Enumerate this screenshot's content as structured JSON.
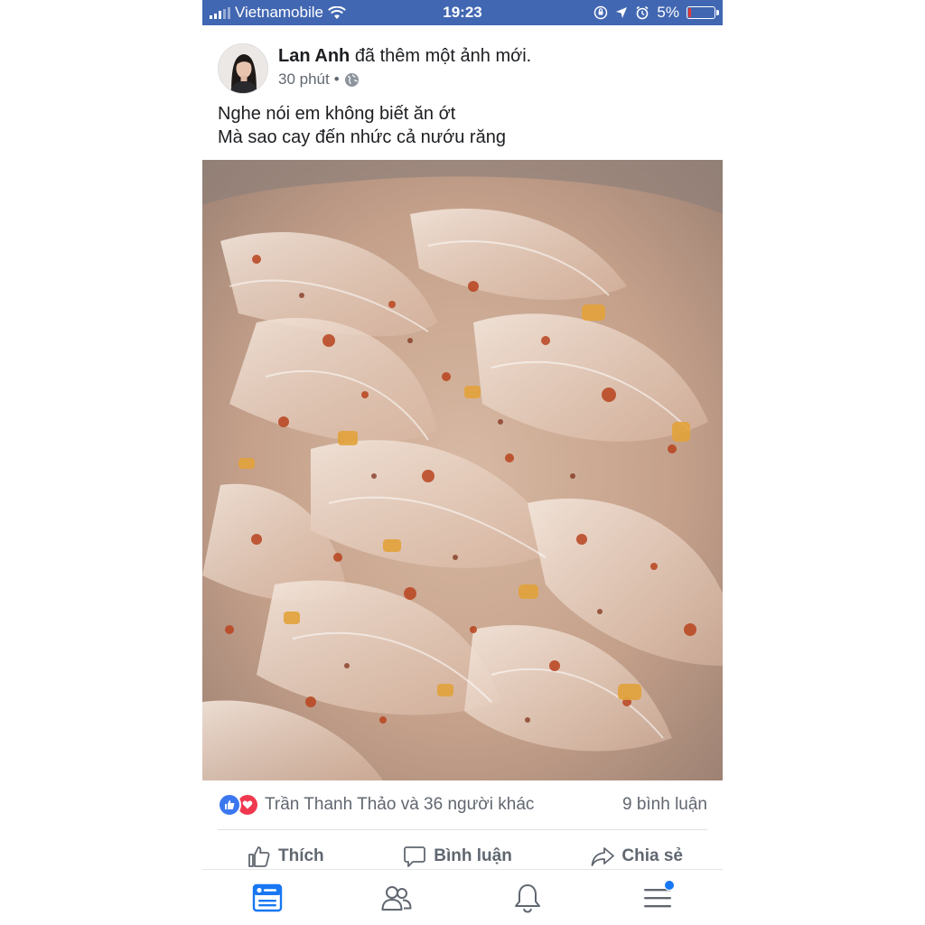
{
  "status_bar": {
    "carrier": "Vietnamobile",
    "time": "19:23",
    "battery": "5%",
    "battery_color": "#e53935",
    "bar_color": "#4267b2"
  },
  "post": {
    "author": "Lan Anh",
    "action": "đã thêm một ảnh mới.",
    "time": "30 phút",
    "separator": "•",
    "privacy_icon": "globe-icon",
    "text_line1": "Nghe nói em không biết ăn ớt",
    "text_line2": "Mà sao cay đến nhức cả nướu răng"
  },
  "engagement": {
    "reactors": "Trần Thanh Thảo và 36 người khác",
    "comments": "9 bình luận",
    "like_color": "#3b78f0",
    "love_color": "#f0384f"
  },
  "actions": {
    "like": "Thích",
    "comment": "Bình luận",
    "share": "Chia sẻ"
  },
  "tabs": [
    "news-feed-icon",
    "friends-icon",
    "notifications-icon",
    "menu-icon"
  ],
  "accent": "#1877f2"
}
